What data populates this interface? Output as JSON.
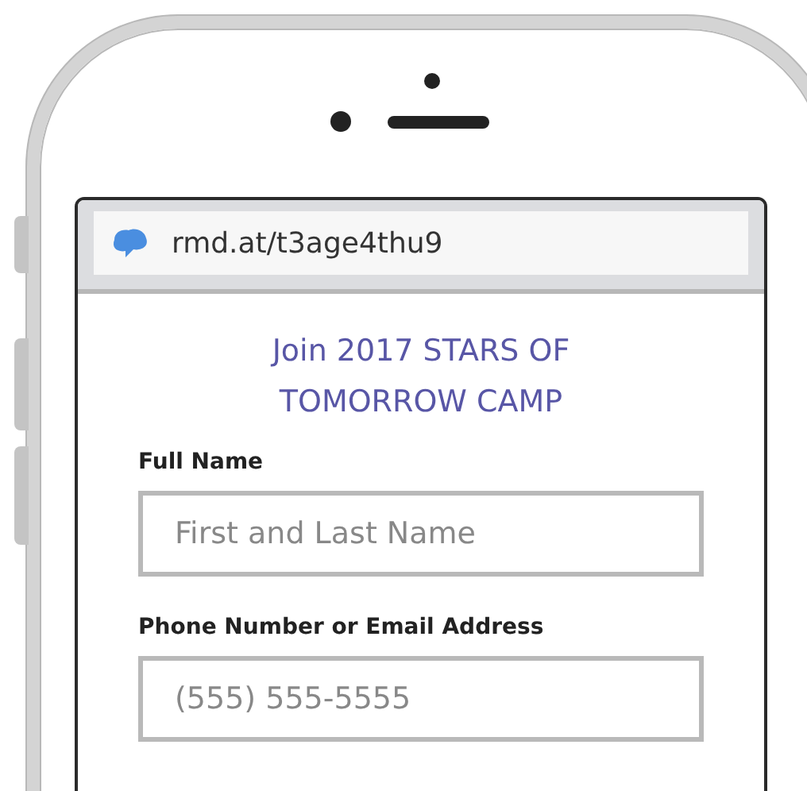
{
  "browser": {
    "url": "rmd.at/t3age4thu9"
  },
  "form": {
    "title": "Join 2017 STARS OF TOMORROW CAMP",
    "fields": [
      {
        "label": "Full Name",
        "placeholder": "First and Last Name"
      },
      {
        "label": "Phone Number or Email Address",
        "placeholder": "(555) 555-5555"
      }
    ]
  }
}
